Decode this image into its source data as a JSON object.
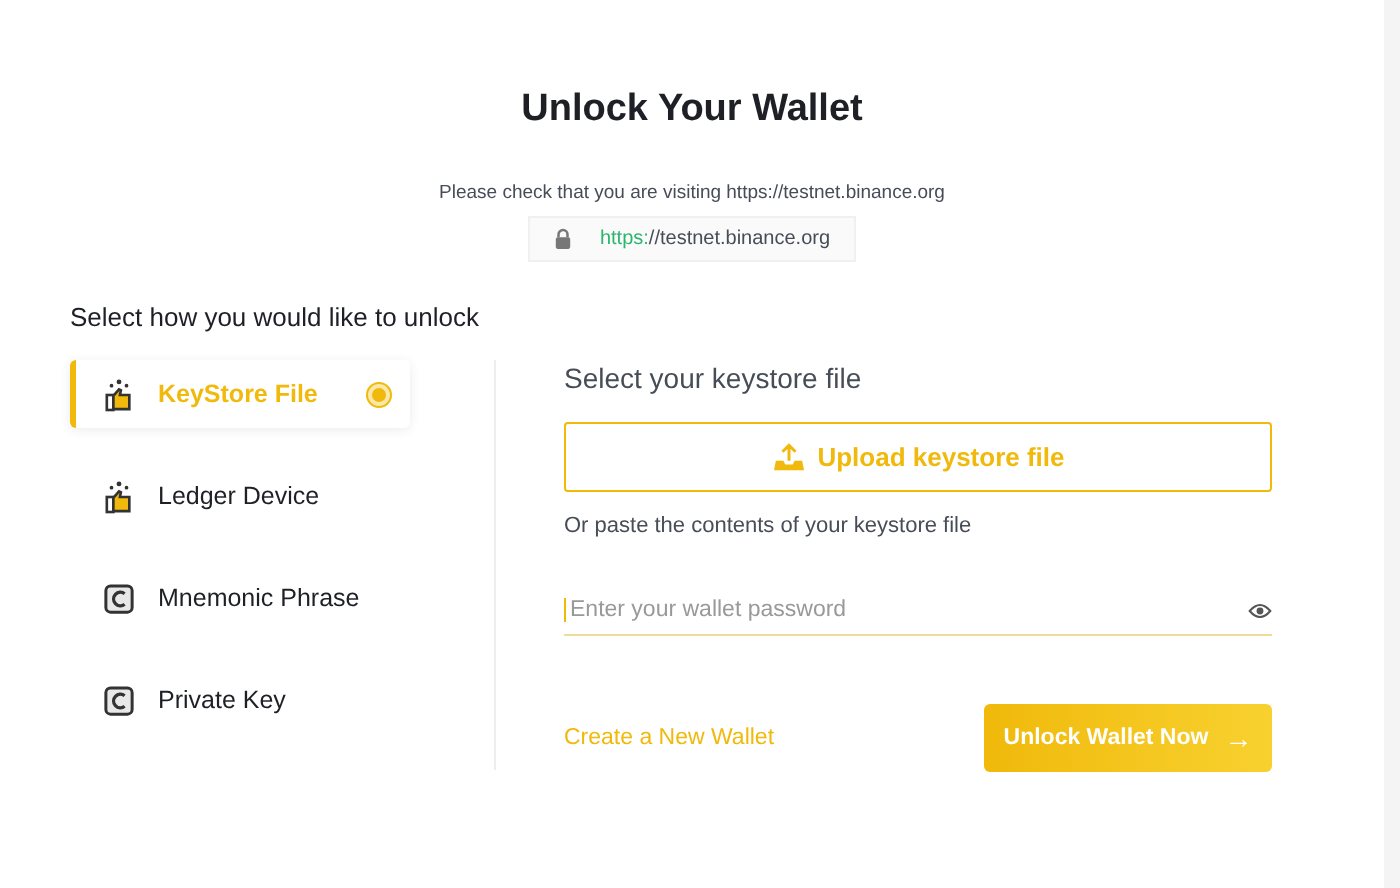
{
  "title": "Unlock Your Wallet",
  "notice": "Please check that you are visiting https://testnet.binance.org",
  "url": {
    "scheme": "https:",
    "rest": "//testnet.binance.org"
  },
  "prompt": "Select how you would like to unlock",
  "methods": [
    {
      "label": "KeyStore File",
      "kind": "thumb",
      "selected": true
    },
    {
      "label": "Ledger Device",
      "kind": "thumb",
      "selected": false
    },
    {
      "label": "Mnemonic Phrase",
      "kind": "coin",
      "selected": false
    },
    {
      "label": "Private Key",
      "kind": "coin",
      "selected": false
    }
  ],
  "panel": {
    "heading": "Select your keystore file",
    "upload": "Upload keystore file",
    "paste_hint": "Or paste the contents of your keystore file",
    "password": {
      "placeholder": "Enter your wallet password"
    },
    "create_link": "Create a New Wallet",
    "unlock_button": "Unlock Wallet Now",
    "unlock_arrow": "→"
  }
}
